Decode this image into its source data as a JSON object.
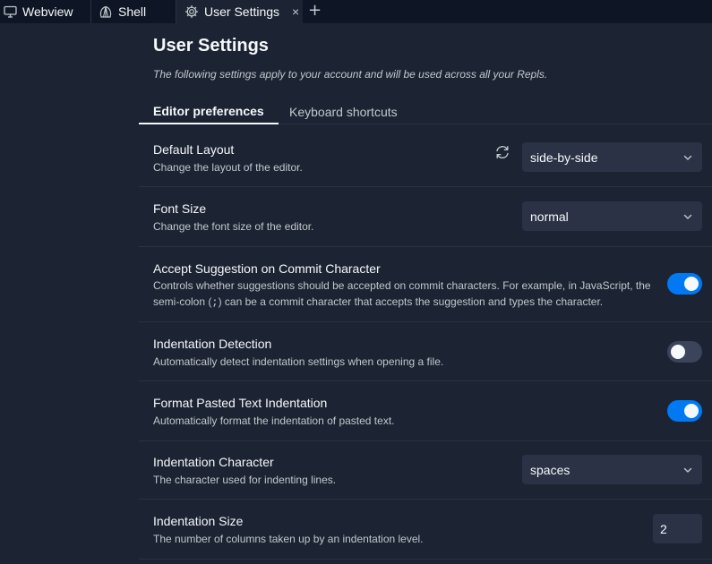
{
  "tabs": [
    {
      "label": "Webview",
      "icon": "monitor-icon"
    },
    {
      "label": "Shell",
      "icon": "shell-icon"
    },
    {
      "label": "User Settings",
      "icon": "gear-icon",
      "active": true
    }
  ],
  "close_symbol": "×",
  "new_tab_symbol": "+",
  "page": {
    "title": "User Settings",
    "description": "The following settings apply to your account and will be used across all your Repls."
  },
  "settings_tabs": [
    {
      "label": "Editor preferences",
      "active": true
    },
    {
      "label": "Keyboard shortcuts",
      "active": false
    }
  ],
  "settings": {
    "default_layout": {
      "title": "Default Layout",
      "desc": "Change the layout of the editor.",
      "value": "side-by-side"
    },
    "font_size": {
      "title": "Font Size",
      "desc": "Change the font size of the editor.",
      "value": "normal"
    },
    "accept_suggestion": {
      "title": "Accept Suggestion on Commit Character",
      "desc_before": "Controls whether suggestions should be accepted on commit characters. For example, in JavaScript, the semi-colon (",
      "desc_code": ";",
      "desc_after": ") can be a commit character that accepts the suggestion and types the character.",
      "enabled": true
    },
    "indent_detection": {
      "title": "Indentation Detection",
      "desc": "Automatically detect indentation settings when opening a file.",
      "enabled": false
    },
    "format_paste": {
      "title": "Format Pasted Text Indentation",
      "desc": "Automatically format the indentation of pasted text.",
      "enabled": true
    },
    "indent_char": {
      "title": "Indentation Character",
      "desc": "The character used for indenting lines.",
      "value": "spaces"
    },
    "indent_size": {
      "title": "Indentation Size",
      "desc": "The number of columns taken up by an indentation level.",
      "value": "2"
    }
  },
  "colors": {
    "accent": "#0079f2",
    "background": "#1c2333",
    "tabbar": "#0e1525",
    "control": "#2b3245"
  }
}
